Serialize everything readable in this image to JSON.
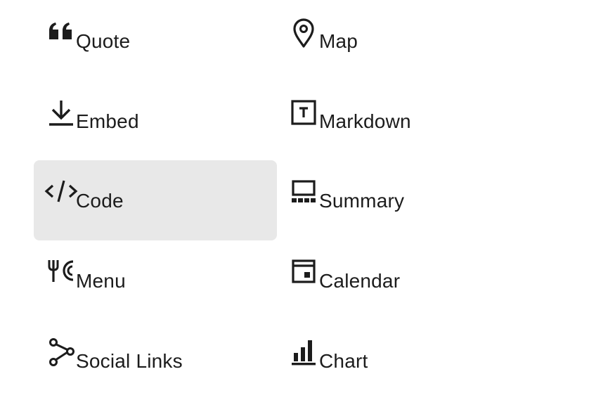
{
  "colors": {
    "text": "#1c1c1c",
    "selected_background": "#e8e8e8",
    "background": "#ffffff"
  },
  "selected_item": "Code",
  "blocks": [
    {
      "label": "Quote",
      "icon": "quote-icon"
    },
    {
      "label": "Map",
      "icon": "map-pin-icon"
    },
    {
      "label": "Embed",
      "icon": "download-icon"
    },
    {
      "label": "Markdown",
      "icon": "markdown-icon"
    },
    {
      "label": "Code",
      "icon": "code-icon"
    },
    {
      "label": "Summary",
      "icon": "summary-icon"
    },
    {
      "label": "Menu",
      "icon": "menu-icon"
    },
    {
      "label": "Calendar",
      "icon": "calendar-icon"
    },
    {
      "label": "Social Links",
      "icon": "share-icon"
    },
    {
      "label": "Chart",
      "icon": "bar-chart-icon"
    }
  ]
}
